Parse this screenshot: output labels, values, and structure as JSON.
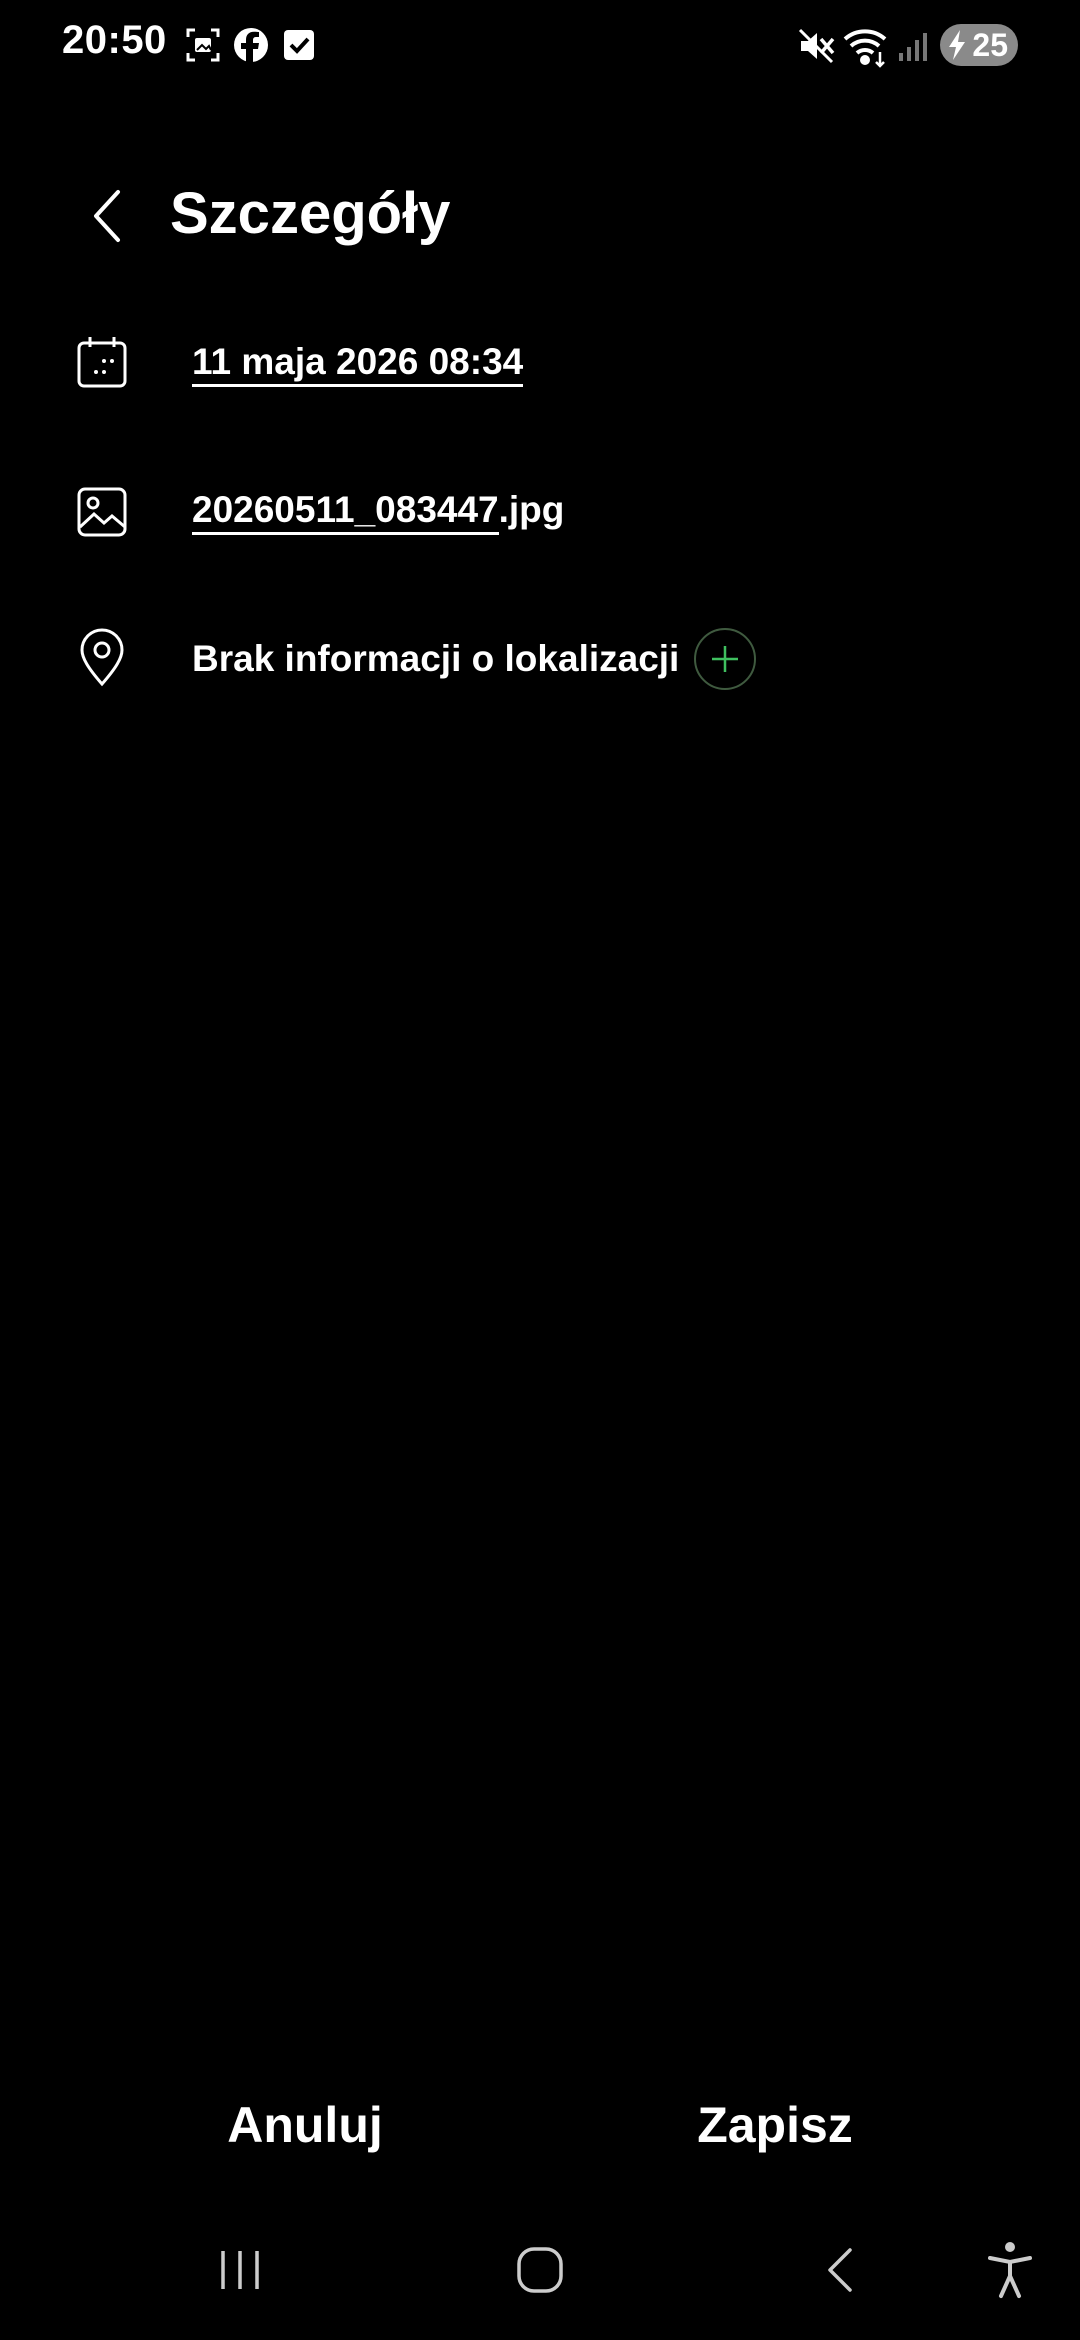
{
  "status_bar": {
    "time": "20:50",
    "left_icons": [
      "screenshot-icon",
      "facebook-icon",
      "checkbox-icon"
    ],
    "right_icons": [
      "mute-icon",
      "wifi-icon",
      "signal-icon"
    ],
    "battery_level": "25",
    "charging": true
  },
  "header": {
    "title": "Szczegóły"
  },
  "details": {
    "date": "11 maja 2026 08:34",
    "filename_base": "20260511_083447",
    "filename_ext": ".jpg",
    "location": "Brak informacji o lokalizacji"
  },
  "actions": {
    "cancel_label": "Anuluj",
    "save_label": "Zapisz"
  },
  "colors": {
    "background": "#000000",
    "text": "#ffffff",
    "accent_green": "#3fbf5f"
  },
  "nav_bar": {
    "buttons": [
      "recent-apps-icon",
      "home-icon",
      "back-icon",
      "accessibility-icon"
    ]
  }
}
